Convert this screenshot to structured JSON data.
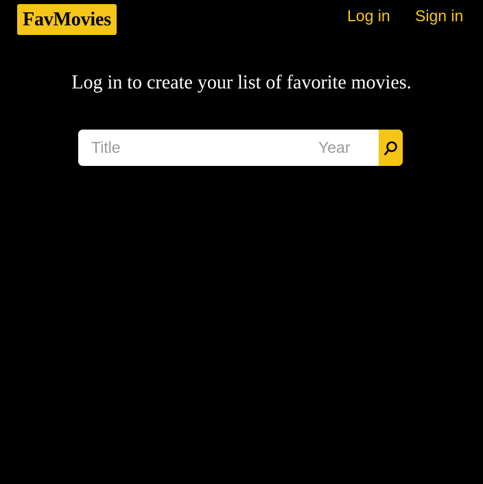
{
  "header": {
    "logo": "FavMovies",
    "nav": {
      "login_label": "Log in",
      "signin_label": "Sign in"
    }
  },
  "main": {
    "tagline": "Log in to create your list of favorite movies.",
    "search": {
      "title_value": "",
      "title_placeholder": "Title",
      "year_value": "",
      "year_placeholder": "Year",
      "button_icon": "search-icon"
    }
  },
  "colors": {
    "background": "#000000",
    "accent": "#f5c518",
    "text_primary": "#ffffff",
    "placeholder": "#9a9a9a"
  }
}
